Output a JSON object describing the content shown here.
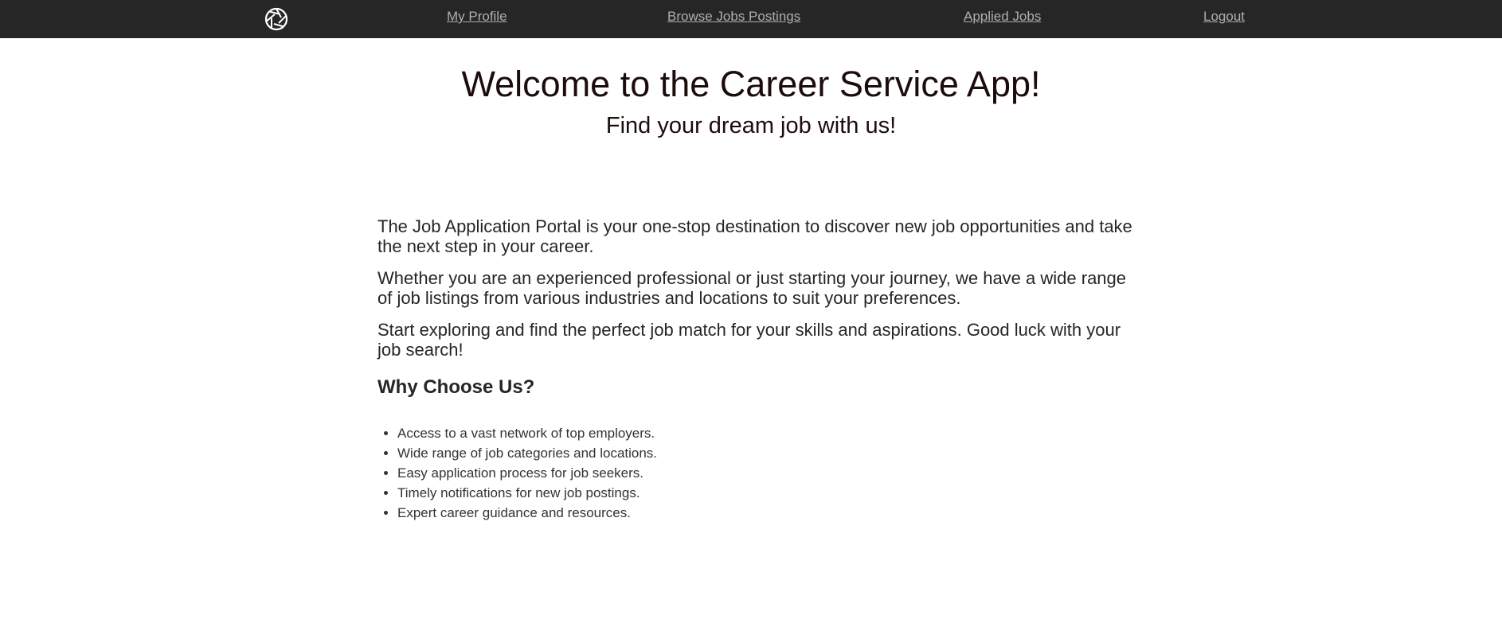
{
  "nav": {
    "logo_icon": "aperture-icon",
    "links": [
      {
        "label": "My Profile"
      },
      {
        "label": "Browse Jobs Postings"
      },
      {
        "label": "Applied Jobs"
      },
      {
        "label": "Logout"
      }
    ]
  },
  "hero": {
    "title": "Welcome to the Career Service App!",
    "subtitle": "Find your dream job with us!"
  },
  "intro": {
    "paragraphs": [
      "The Job Application Portal is your one-stop destination to discover new job opportunities and take the next step in your career.",
      "Whether you are an experienced professional or just starting your journey, we have a wide range of job listings from various industries and locations to suit your preferences.",
      "Start exploring and find the perfect job match for your skills and aspirations. Good luck with your job search!"
    ]
  },
  "why": {
    "heading": "Why Choose Us?",
    "items": [
      "Access to a vast network of top employers.",
      "Wide range of job categories and locations.",
      "Easy application process for job seekers.",
      "Timely notifications for new job postings.",
      "Expert career guidance and resources."
    ]
  },
  "colors": {
    "navbar_bg": "#262626",
    "nav_link": "#aeaeae",
    "heading_text": "#1c0c0c",
    "body_text": "#262626"
  }
}
